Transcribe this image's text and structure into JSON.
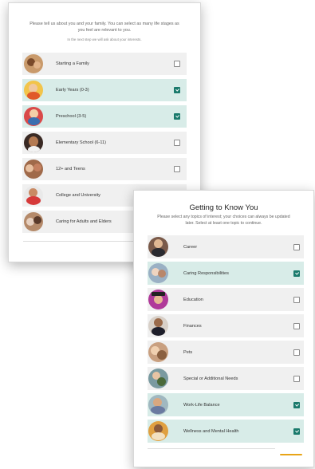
{
  "life_stages": {
    "intro": "Please tell us about you and your family. You can select as many life stages as you feel are relevant to you.",
    "subtext": "In the next step we will ask about your interests.",
    "items": [
      {
        "label": "Starting a Family",
        "checked": false,
        "icon": "family-photo"
      },
      {
        "label": "Early Years (0-3)",
        "checked": true,
        "icon": "baby-photo"
      },
      {
        "label": "Preschool (3-5)",
        "checked": true,
        "icon": "preschooler-photo"
      },
      {
        "label": "Elementary School (6-11)",
        "checked": false,
        "icon": "child-photo"
      },
      {
        "label": "12+ and Teens",
        "checked": false,
        "icon": "teens-photo"
      },
      {
        "label": "College and University",
        "checked": false,
        "icon": "student-photo"
      },
      {
        "label": "Caring for Adults and Elders",
        "checked": false,
        "icon": "elder-care-photo"
      }
    ]
  },
  "topics": {
    "title": "Getting to Know You",
    "intro": "Please select any topics of interest; your choices can always be updated later. Select at least one topic to continue.",
    "items": [
      {
        "label": "Career",
        "checked": false,
        "icon": "career-photo"
      },
      {
        "label": "Caring Responsibilities",
        "checked": true,
        "icon": "caregiving-photo"
      },
      {
        "label": "Education",
        "checked": false,
        "icon": "graduate-photo"
      },
      {
        "label": "Finances",
        "checked": false,
        "icon": "finances-photo"
      },
      {
        "label": "Pets",
        "checked": false,
        "icon": "pets-photo"
      },
      {
        "label": "Special or Additional Needs",
        "checked": false,
        "icon": "special-needs-photo"
      },
      {
        "label": "Work-Life Balance",
        "checked": true,
        "icon": "work-life-photo"
      },
      {
        "label": "Wellness and Mental Health",
        "checked": true,
        "icon": "wellness-photo"
      }
    ]
  },
  "colors": {
    "selected_row": "#d8ece8",
    "row": "#f0f0f0",
    "checkbox_on": "#1a7a6c",
    "accent": "#e8a417"
  }
}
